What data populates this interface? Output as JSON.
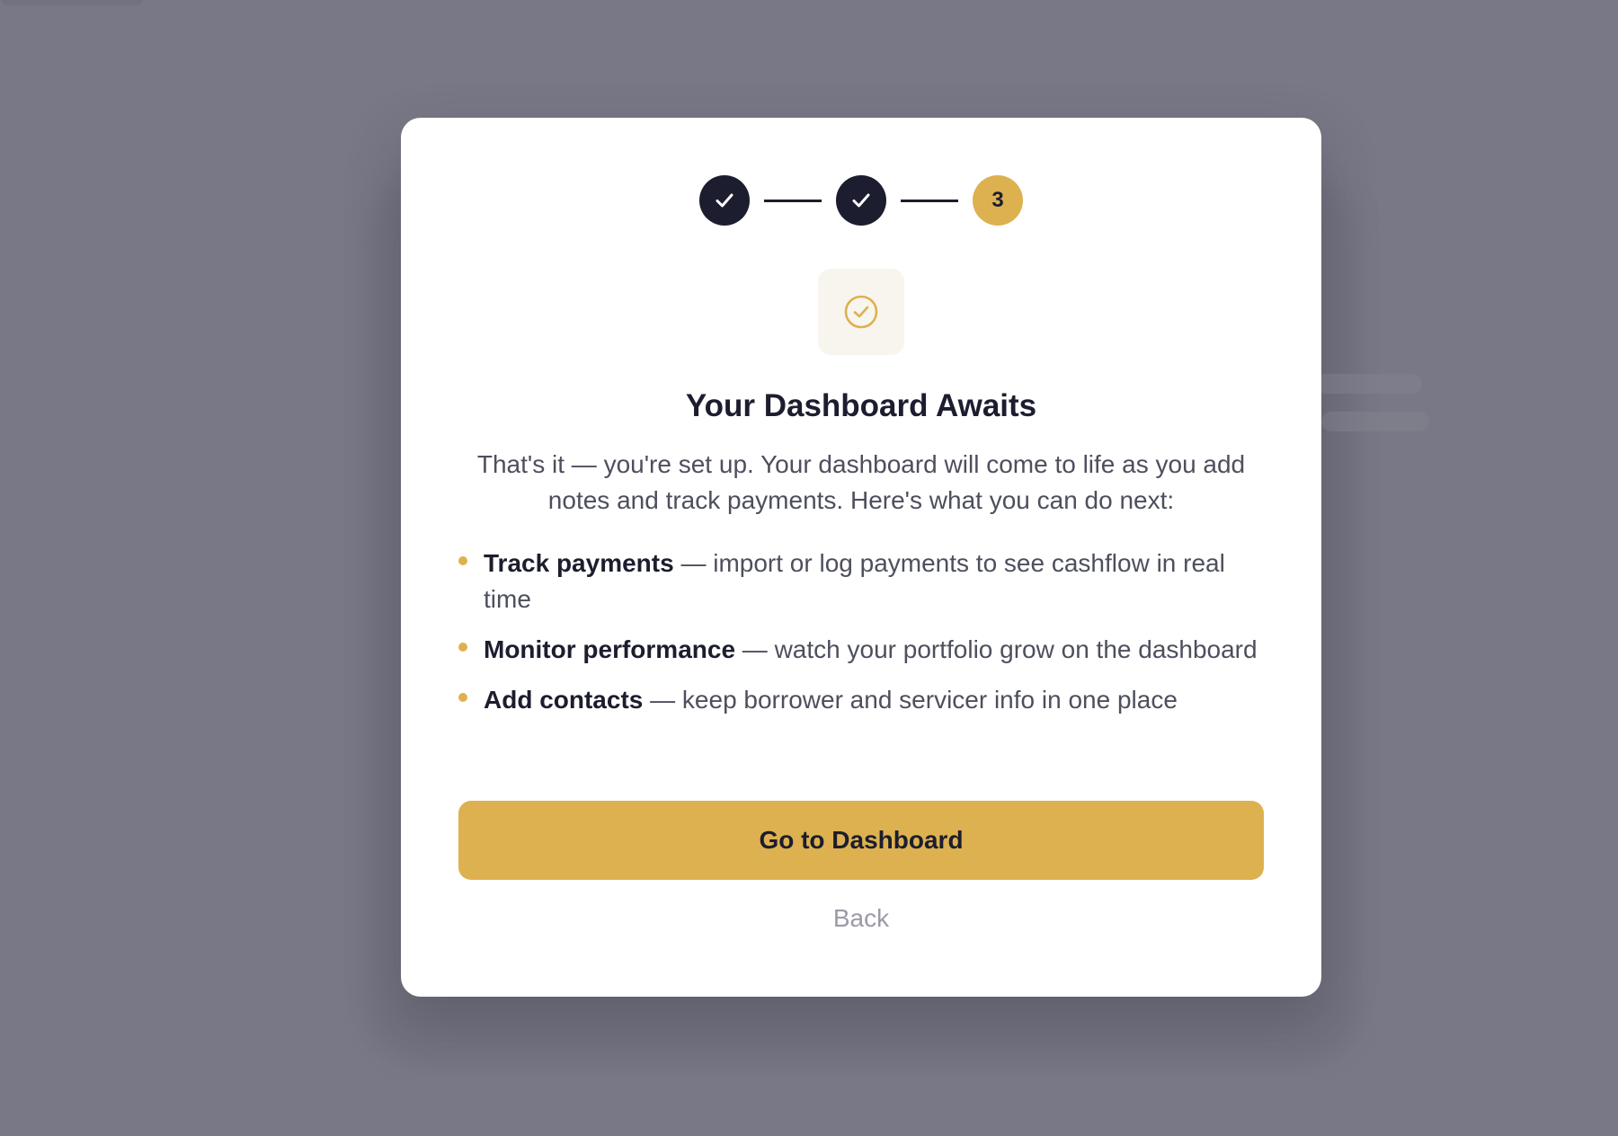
{
  "stepper": {
    "steps": [
      {
        "state": "complete",
        "icon": "check-icon"
      },
      {
        "state": "complete",
        "icon": "check-icon"
      },
      {
        "state": "current",
        "label": "3"
      }
    ]
  },
  "success_icon": "check-circle-icon",
  "title": "Your Dashboard Awaits",
  "subtitle": "That's it — you're set up. Your dashboard will come to life as you add notes and track payments. Here's what you can do next:",
  "features": [
    {
      "title": "Track payments",
      "description": " — import or log payments to see cashflow in real time"
    },
    {
      "title": "Monitor performance",
      "description": " — watch your portfolio grow on the dashboard"
    },
    {
      "title": "Add contacts",
      "description": " — keep borrower and servicer info in one place"
    }
  ],
  "primary_button": "Go to Dashboard",
  "back_link": "Back",
  "colors": {
    "accent": "#ddb14f",
    "dark": "#1c1d2e",
    "overlay": "#787886",
    "muted_text": "#9a9ba6"
  }
}
